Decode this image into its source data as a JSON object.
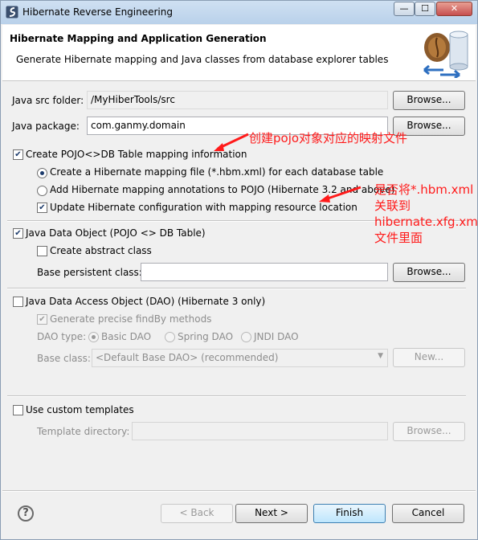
{
  "window": {
    "title": "Hibernate Reverse Engineering",
    "minimize": "—",
    "maximize": "☐",
    "close": "✕"
  },
  "header": {
    "title": "Hibernate Mapping and Application Generation",
    "subtitle": "Generate Hibernate mapping and Java classes from database explorer tables"
  },
  "src_folder": {
    "label": "Java src folder:",
    "value": "/MyHiberTools/src",
    "browse": "Browse..."
  },
  "package": {
    "label": "Java package:",
    "value": "com.ganmy.domain",
    "browse": "Browse..."
  },
  "pojo": {
    "label": "Create POJO<>DB Table mapping information",
    "checked": true,
    "opt_file": "Create a Hibernate mapping file (*.hbm.xml) for each database table",
    "opt_annotations": "Add Hibernate mapping annotations to POJO (Hibernate 3.2 and above)",
    "update_config": "Update Hibernate configuration with mapping resource location"
  },
  "java_data_object": {
    "label": "Java Data Object (POJO <> DB Table)",
    "checked": true,
    "abstract_label": "Create abstract class",
    "base_label": "Base persistent class:",
    "base_value": "",
    "browse": "Browse..."
  },
  "dao": {
    "label": "Java Data Access Object (DAO) (Hibernate 3 only)",
    "findby": "Generate precise findBy methods",
    "type_label": "DAO type:",
    "types": [
      "Basic DAO",
      "Spring DAO",
      "JNDI DAO"
    ],
    "base_label": "Base class:",
    "base_value": "<Default Base DAO> (recommended)",
    "new_button": "New..."
  },
  "templates": {
    "label": "Use custom templates",
    "dir_label": "Template directory:",
    "dir_value": "",
    "browse": "Browse..."
  },
  "footer": {
    "help": "?",
    "back": "< Back",
    "next": "Next >",
    "finish": "Finish",
    "cancel": "Cancel"
  },
  "annotations": {
    "note1": "创建pojo对象对应的映射文件",
    "note2": "是否将*.hbm.xml关联到hibernate.xfg.xml文件里面",
    "note2_lines": [
      "是否将*.hbm.xml",
      "关联到",
      "hibernate.xfg.xml",
      "文件里面"
    ]
  },
  "colors": {
    "annotation": "#ff1a1a",
    "titlebar": "#cfe0f2"
  }
}
